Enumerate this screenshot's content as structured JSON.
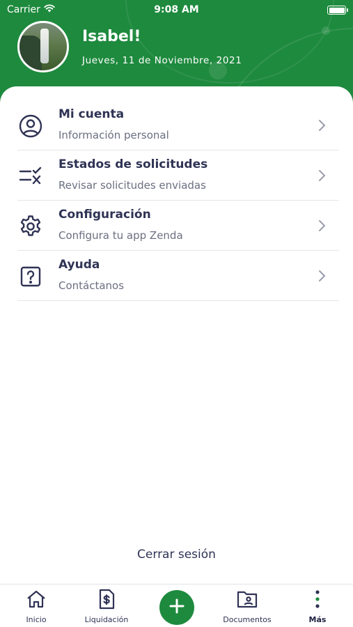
{
  "status_bar": {
    "carrier": "Carrier",
    "time": "9:08 AM"
  },
  "profile": {
    "name": "Isabel!",
    "date": "Jueves, 11 de Noviembre, 2021"
  },
  "menu": {
    "items": [
      {
        "title": "Mi cuenta",
        "subtitle": "Información personal",
        "icon": "user-circle-icon"
      },
      {
        "title": "Estados de solicitudes",
        "subtitle": "Revisar solicitudes enviadas",
        "icon": "checklist-icon"
      },
      {
        "title": "Configuración",
        "subtitle": "Configura tu app Zenda",
        "icon": "gear-icon"
      },
      {
        "title": "Ayuda",
        "subtitle": "Contáctanos",
        "icon": "help-icon"
      }
    ]
  },
  "logout_label": "Cerrar sesión",
  "tabbar": {
    "tabs": [
      {
        "label": "Inicio",
        "icon": "home-icon"
      },
      {
        "label": "Liquidación",
        "icon": "receipt-icon"
      },
      {
        "label": "Documentos",
        "icon": "folder-icon"
      },
      {
        "label": "Más",
        "icon": "more-icon",
        "active": true
      }
    ],
    "fab_icon": "plus-icon"
  },
  "colors": {
    "brand_green": "#1e8a3e",
    "text_dark": "#2f3354",
    "text_muted": "#6b6e80"
  }
}
